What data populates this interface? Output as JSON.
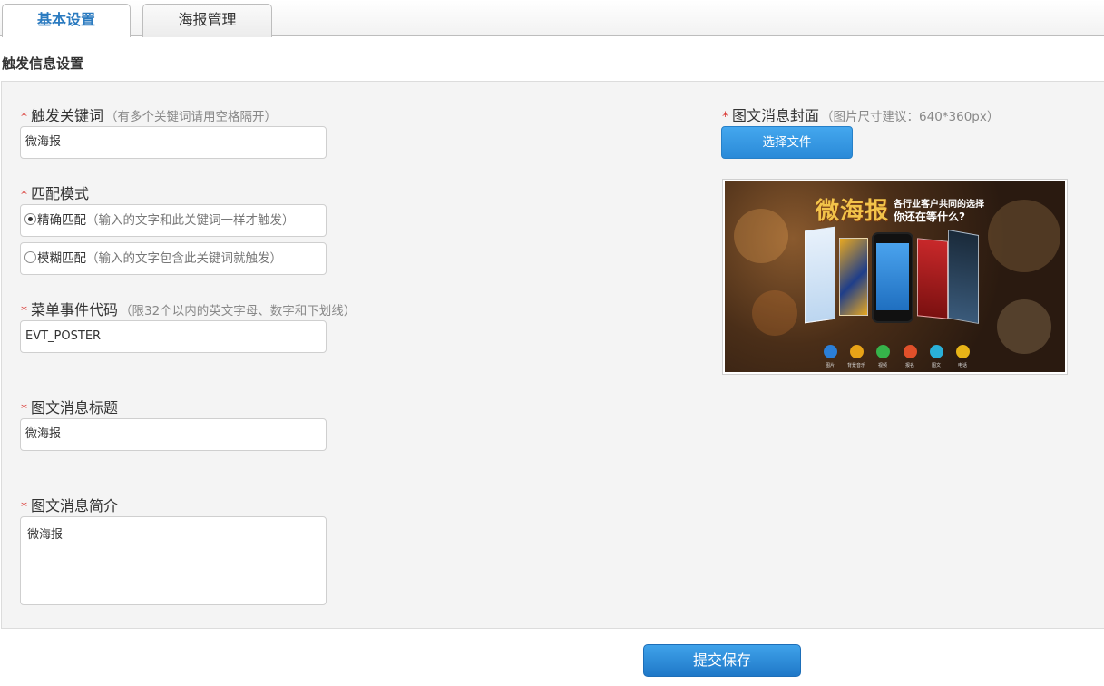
{
  "tabs": [
    {
      "label": "基本设置",
      "active": true
    },
    {
      "label": "海报管理",
      "active": false
    }
  ],
  "section_title": "触发信息设置",
  "fields": {
    "keyword": {
      "label": "触发关键词",
      "hint": "（有多个关键词请用空格隔开）",
      "value": "微海报"
    },
    "match_mode": {
      "label": "匹配模式",
      "options": [
        {
          "label": "精确匹配",
          "hint": "（输入的文字和此关键词一样才触发）",
          "checked": true
        },
        {
          "label": "模糊匹配",
          "hint": "（输入的文字包含此关键词就触发）",
          "checked": false
        }
      ]
    },
    "event_code": {
      "label": "菜单事件代码",
      "hint": "（限32个以内的英文字母、数字和下划线）",
      "value": "EVT_POSTER"
    },
    "news_title": {
      "label": "图文消息标题",
      "value": "微海报"
    },
    "news_desc": {
      "label": "图文消息简介",
      "value": "微海报"
    },
    "cover": {
      "label": "图文消息封面",
      "hint": "（图片尺寸建议：640*360px）",
      "button_label": "选择文件"
    }
  },
  "poster": {
    "title": "微海报",
    "subtitle_line1": "各行业客户共同的选择",
    "subtitle_line2": "你还在等什么?",
    "icons": [
      {
        "name": "picture-icon",
        "label": "图片",
        "color": "#2b7fd8"
      },
      {
        "name": "music-icon",
        "label": "背景音乐",
        "color": "#e8a317"
      },
      {
        "name": "video-icon",
        "label": "视频",
        "color": "#36b34a"
      },
      {
        "name": "signup-icon",
        "label": "报名",
        "color": "#e0502a"
      },
      {
        "name": "news-icon",
        "label": "图文",
        "color": "#2ab0d8"
      },
      {
        "name": "phone-icon",
        "label": "电话",
        "color": "#e8b417"
      }
    ]
  },
  "submit_label": "提交保存",
  "required_mark": "*"
}
